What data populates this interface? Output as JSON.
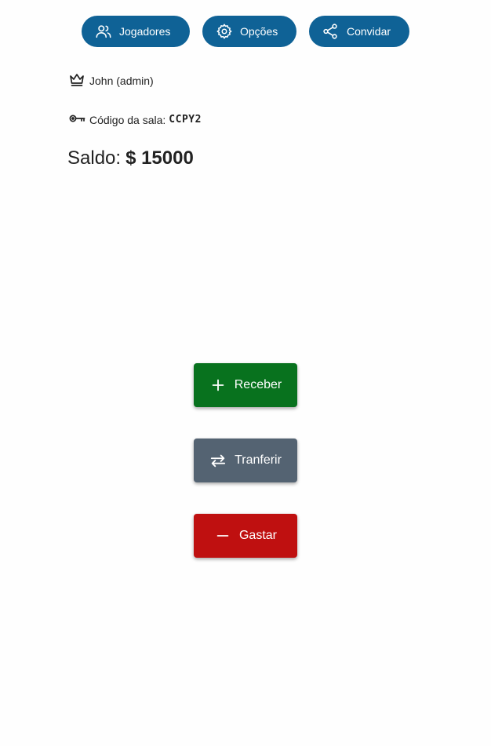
{
  "header": {
    "players_label": "Jogadores",
    "options_label": "Opções",
    "invite_label": "Convidar"
  },
  "room": {
    "user_text": "John (admin)",
    "code_label": "Código da sala:",
    "code_value": "CCPY2"
  },
  "balance": {
    "label": "Saldo:",
    "amount": "$ 15000"
  },
  "actions": {
    "receive_label": "Receber",
    "transfer_label": "Tranferir",
    "spend_label": "Gastar"
  },
  "colors": {
    "header_button": "#0f6296",
    "receive": "#08721e",
    "transfer": "#546372",
    "spend": "#bf1010"
  },
  "icons": {
    "players": "users-icon",
    "options": "gear-icon",
    "invite": "share-icon",
    "user": "crown-icon",
    "code": "key-icon",
    "receive": "plus-icon",
    "transfer": "swap-arrows-icon",
    "spend": "minus-icon"
  }
}
